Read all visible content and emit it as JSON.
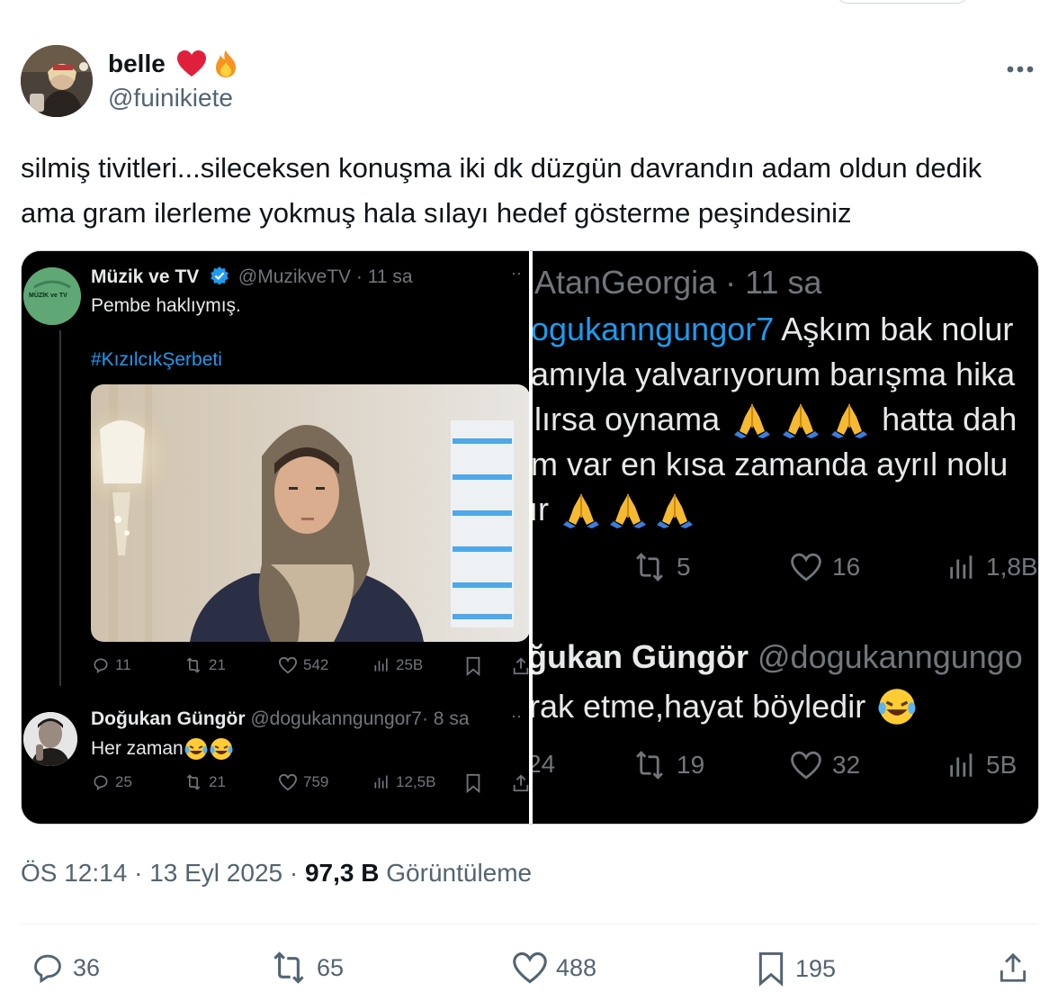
{
  "author": {
    "display_name": "belle",
    "handle": "@fuinikiete",
    "name_emojis": [
      "heart-icon",
      "fire-icon"
    ]
  },
  "tweet": {
    "text": "silmiş tivitleri...sileceksen konuşma iki dk düzgün davrandın adam oldun dedik ama gram ilerleme yokmuş hala sılayı hedef gösterme peşindesiniz"
  },
  "left_screenshot": {
    "tweet1": {
      "name": "Müzik ve TV",
      "handle": "@MuzikveTV",
      "time": "· 11 sa",
      "avatar_text": "MÜZİK ve TV",
      "text": "Pembe haklıymış.",
      "hashtag": "#KızılcıkŞerbeti",
      "replies": "11",
      "retweets": "21",
      "likes": "542",
      "views": "25B"
    },
    "tweet2": {
      "name": "Doğukan Güngör",
      "handle": "@dogukanngungor7",
      "time": "· 8 sa",
      "text": "Her zaman",
      "replies": "25",
      "retweets": "21",
      "likes": "759",
      "views": "12,5B"
    }
  },
  "right_screenshot": {
    "header": "AtanGeorgia · 11 sa",
    "mention": "ogukanngungor7",
    "line1_rest": " Aşkım bak nolur",
    "line2": "amıyla yalvarıyorum barışma hika",
    "line3a": "lırsa oynama",
    "line3b": "hatta dah",
    "line4": "m var en kısa zamanda ayrıl nolu",
    "line5": "ır",
    "retweets": "5",
    "likes": "16",
    "views": "1,8B",
    "reply_name": "ğukan Güngör",
    "reply_handle": "@dogukanngungo",
    "reply_text": "rak etme,hayat böyledir",
    "reply_replies": "24",
    "reply_retweets": "19",
    "reply_likes": "32",
    "reply_views": "5B"
  },
  "meta": {
    "time": "ÖS 12:14",
    "date": "13 Eyl 2025",
    "views_count": "97,3 B",
    "views_label": "Görüntüleme"
  },
  "actions": {
    "replies": "36",
    "retweets": "65",
    "likes": "488",
    "bookmarks": "195"
  },
  "colors": {
    "text": "#0f1419",
    "muted": "#536471",
    "link": "#1d9bf0",
    "dark_bg": "#000000"
  }
}
